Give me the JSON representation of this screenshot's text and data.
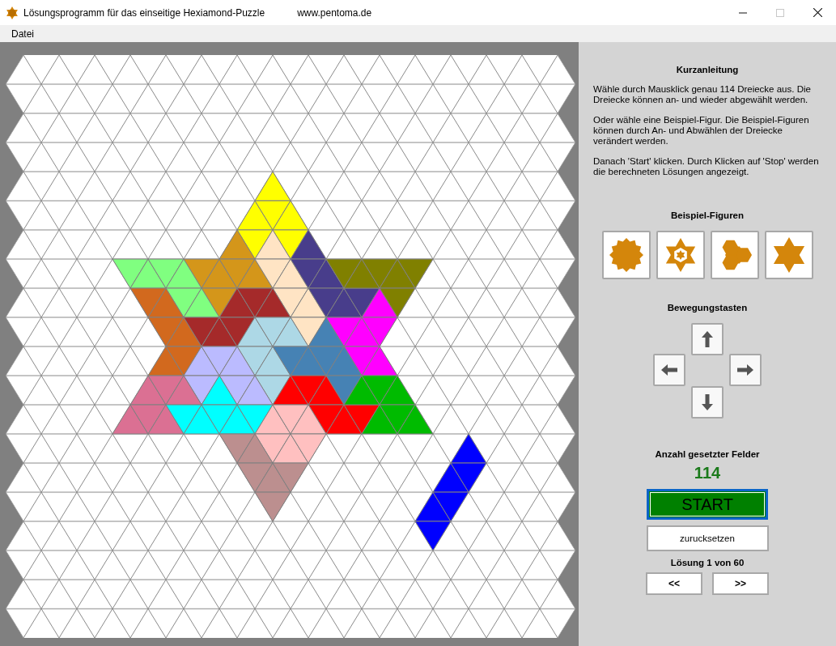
{
  "window": {
    "title": "Lösungsprogramm für das einseitige Hexiamond-Puzzle",
    "url": "www.pentoma.de",
    "controls": [
      {
        "kind": "minimize",
        "disabled": false
      },
      {
        "kind": "maximize",
        "disabled": true
      },
      {
        "kind": "close",
        "disabled": false
      }
    ]
  },
  "menu": [
    "Datei"
  ],
  "board": {
    "pieces": [
      {
        "color": "#ffff00"
      },
      {
        "color": "#d4961a"
      },
      {
        "color": "#ffe4c4"
      },
      {
        "color": "#483d8b"
      },
      {
        "color": "#808000"
      },
      {
        "color": "#80ff80"
      },
      {
        "color": "#d2691e"
      },
      {
        "color": "#a52a2a"
      },
      {
        "color": "#ff00ff"
      },
      {
        "color": "#add8e6"
      },
      {
        "color": "#4682b4"
      },
      {
        "color": "#bbbbff"
      },
      {
        "color": "#db7093"
      },
      {
        "color": "#00ffff"
      },
      {
        "color": "#ff0000"
      },
      {
        "color": "#00bb00"
      },
      {
        "color": "#ffc0c0"
      },
      {
        "color": "#bc8f8f"
      },
      {
        "color": "#0000ff"
      }
    ]
  },
  "panel": {
    "title": "Kurzanleitung",
    "paragraphs": [
      "Wähle durch Mausklick genau 114 Dreiecke aus. Die Dreiecke können an- und wieder abgewählt werden.",
      "Oder wähle eine Beispiel-Figur. Die Beispiel-Figuren können durch An- und Abwählen der Dreiecke verändert werden.",
      "Danach 'Start' klicken. Durch Klicken auf 'Stop' werden die berechneten Lösungen angezeigt."
    ],
    "examples": {
      "title": "Beispiel-Figuren",
      "figures": [
        {
          "kind": "flower"
        },
        {
          "kind": "star-ring"
        },
        {
          "kind": "propeller"
        },
        {
          "kind": "star"
        }
      ]
    },
    "movement": {
      "title": "Bewegungstasten",
      "keys": [
        {
          "kind": "up"
        },
        {
          "kind": "left"
        },
        {
          "kind": "right"
        },
        {
          "kind": "down"
        }
      ]
    },
    "count": {
      "title": "Anzahl gesetzter Felder",
      "value": "114"
    },
    "start": "START",
    "reset": "zurucksetzen",
    "solution": "Lösung 1 von 60",
    "nav": [
      "<<",
      ">>"
    ]
  }
}
